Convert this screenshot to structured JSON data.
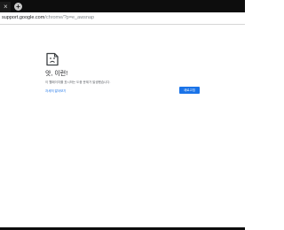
{
  "browser": {
    "tab": {
      "close_glyph": "×"
    },
    "new_tab_glyph": "+",
    "address": {
      "host": "support.google.com",
      "path": "/chrome/?p=e_awsnap"
    }
  },
  "error_page": {
    "icon": "sad-page-icon",
    "title": "앗, 이런!",
    "description": "이 웹페이지를 표시하는 도중 문제가 발생했습니다.",
    "learn_more": "자세히 알아보기",
    "reload_label": "새로고침",
    "accent": "#1a73e8"
  }
}
